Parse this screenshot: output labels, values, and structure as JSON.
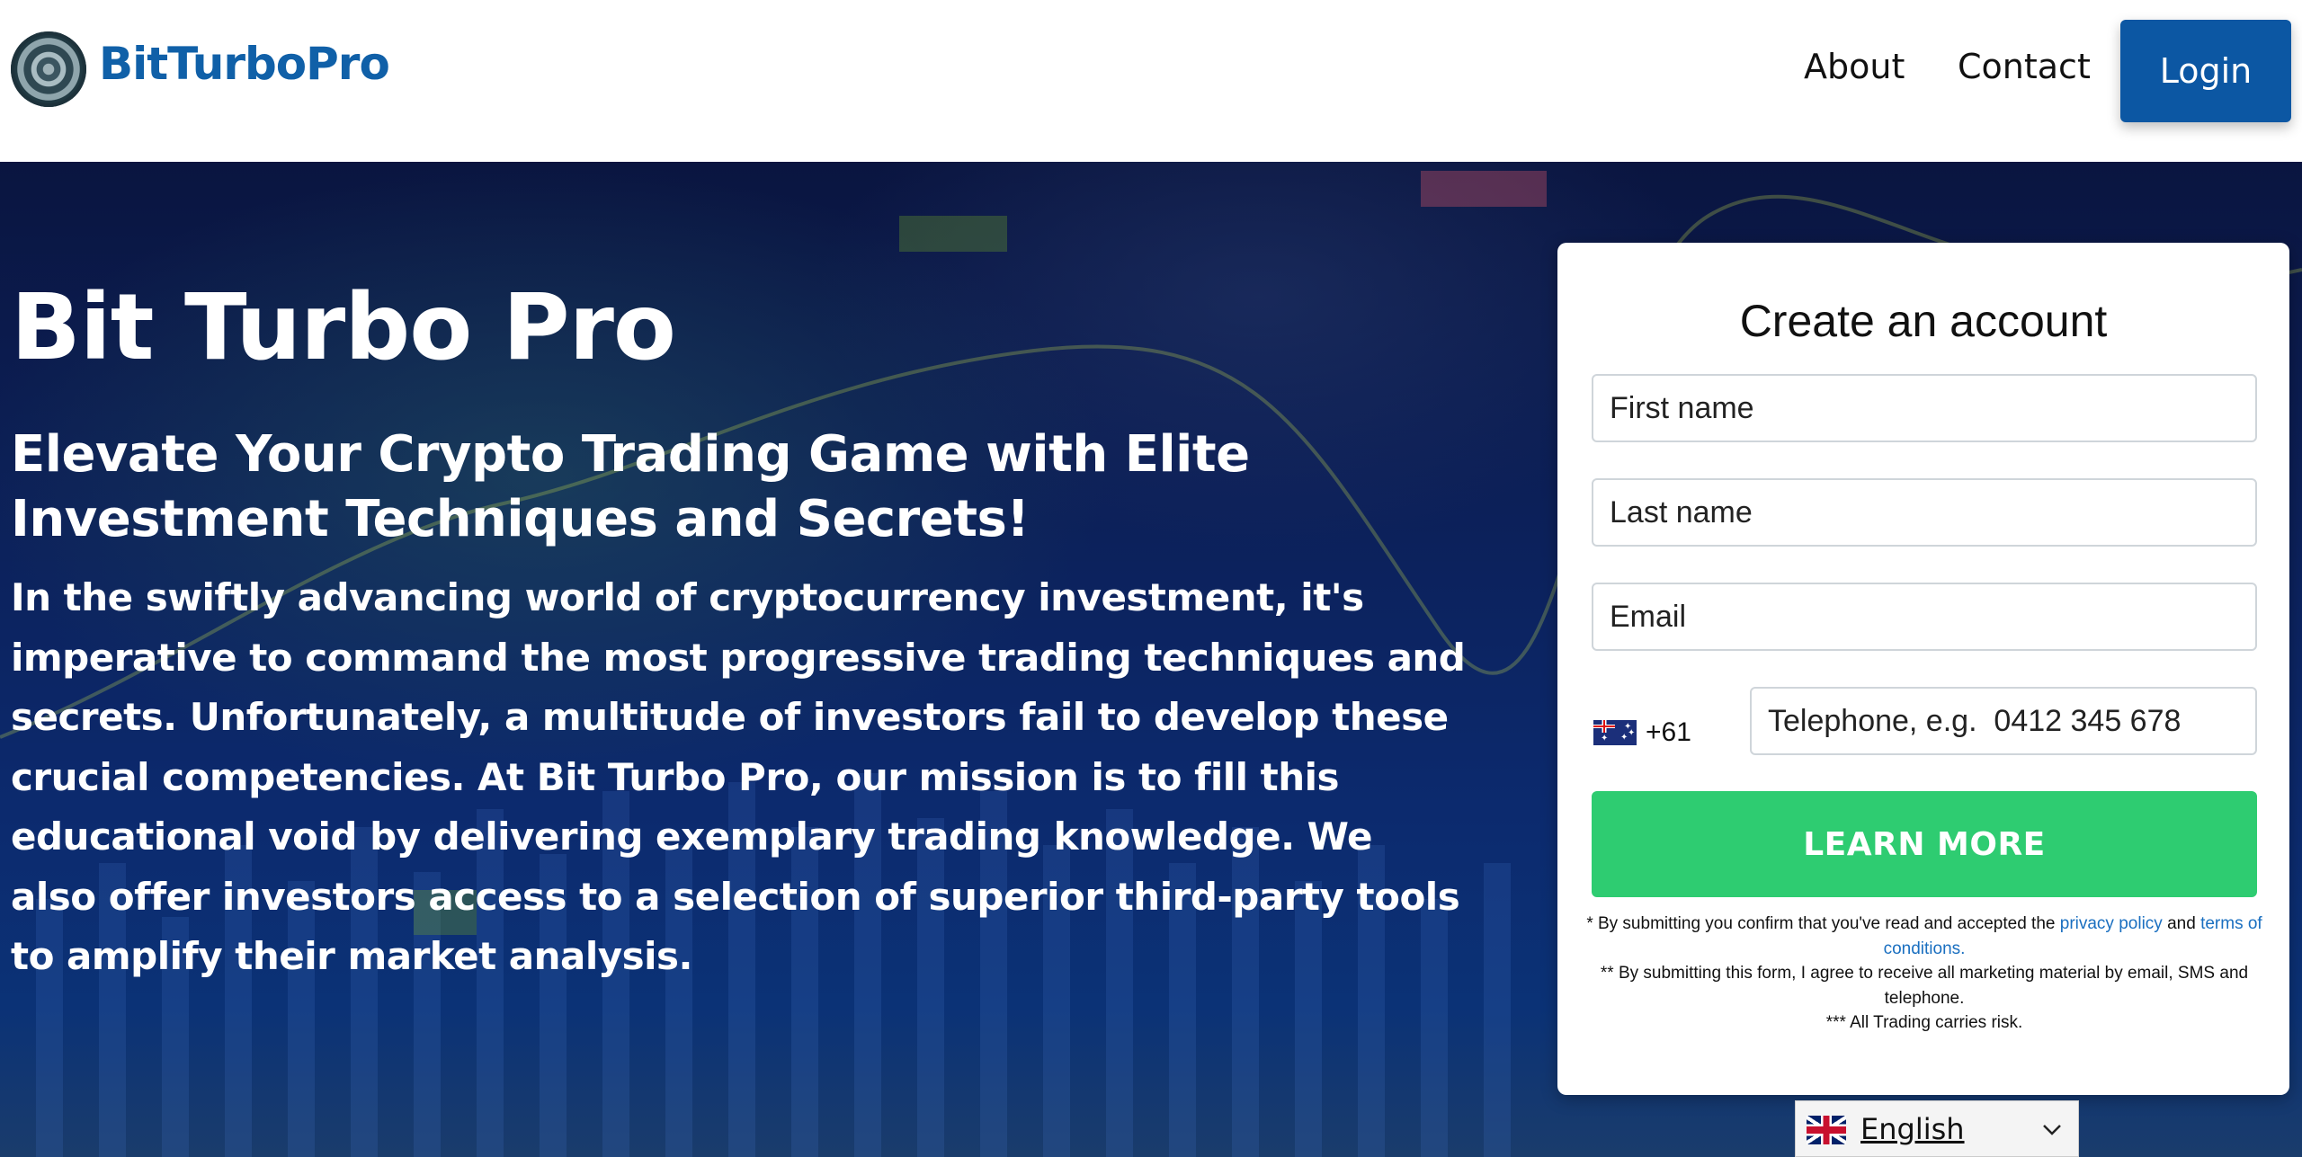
{
  "header": {
    "brand": "BitTurboPro",
    "nav": {
      "about": "About",
      "contact": "Contact"
    },
    "login_label": "Login",
    "brand_color": "#1060a8",
    "login_color": "#0c57a3"
  },
  "hero": {
    "title": "Bit Turbo Pro",
    "subtitle": "Elevate Your Crypto Trading Game with Elite Investment Techniques and Secrets!",
    "body": "In the swiftly advancing world of cryptocurrency investment, it's imperative to command the most progressive trading techniques and secrets. Unfortunately, a multitude of investors fail to develop these crucial competencies. At Bit Turbo Pro, our mission is to fill this educational void by delivering exemplary trading knowledge. We also offer investors access to a selection of superior third-party tools to amplify their market analysis.",
    "background_icon": "blurred-trading-chart"
  },
  "signup": {
    "title": "Create an account",
    "first_name_placeholder": "First name",
    "last_name_placeholder": "Last name",
    "email_placeholder": "Email",
    "phone": {
      "flag_icon": "australia-flag-icon",
      "dial_code": "+61",
      "caret": "▼",
      "placeholder": "Telephone, e.g.  0412 345 678"
    },
    "submit_label": "LEARN MORE",
    "submit_color": "#2ecc71",
    "disclaimer": {
      "line1_prefix": "* By submitting you confirm that you've read and accepted the ",
      "privacy_link": "privacy policy",
      "and_text": " and ",
      "terms_link": "terms of conditions.",
      "line2": "** By submitting this form, I agree to receive all marketing material by email, SMS and telephone.",
      "line3": "*** All Trading carries risk."
    }
  },
  "language": {
    "flag_icon": "uk-flag-icon",
    "label": "English",
    "chevron_icon": "chevron-down-icon"
  }
}
